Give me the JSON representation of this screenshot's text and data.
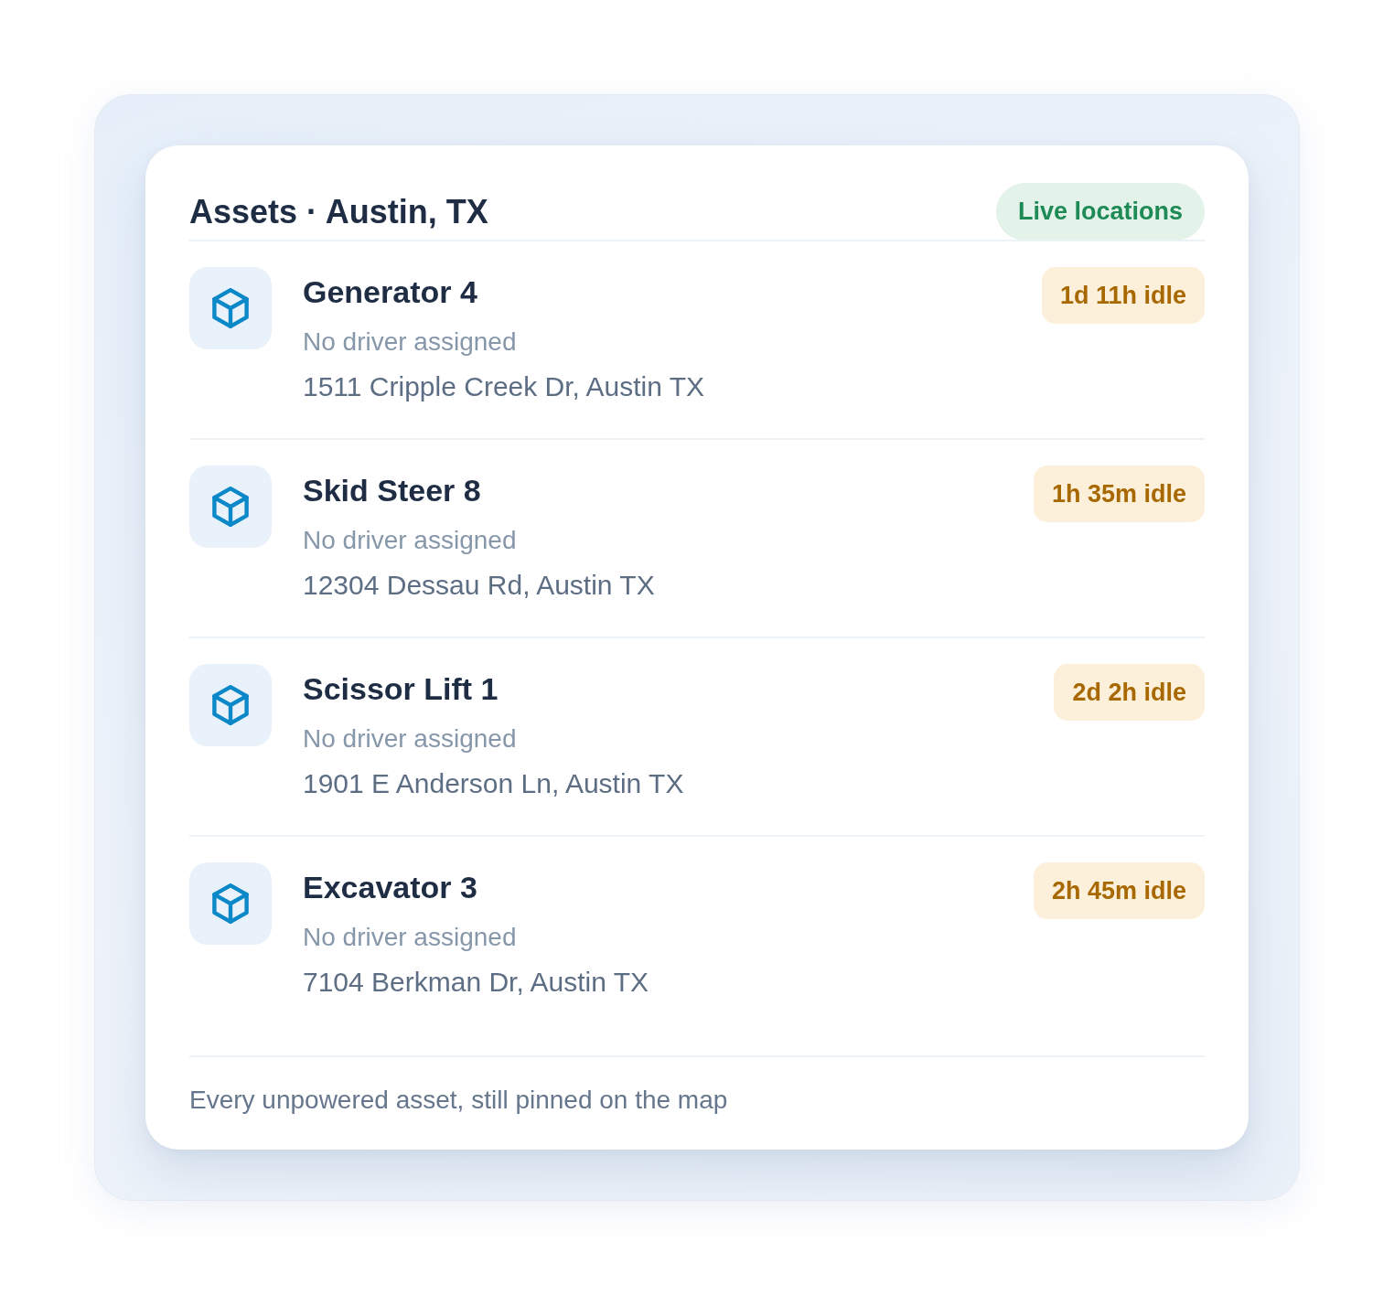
{
  "header": {
    "title": "Assets · Austin, TX",
    "badge": "Live locations"
  },
  "assets": [
    {
      "name": "Generator 4",
      "driver": "No driver assigned",
      "address": "1511 Cripple Creek Dr, Austin TX",
      "idle": "1d 11h idle"
    },
    {
      "name": "Skid Steer 8",
      "driver": "No driver assigned",
      "address": "12304 Dessau Rd, Austin TX",
      "idle": "1h 35m idle"
    },
    {
      "name": "Scissor Lift 1",
      "driver": "No driver assigned",
      "address": "1901 E Anderson Ln, Austin TX",
      "idle": "2d 2h idle"
    },
    {
      "name": "Excavator 3",
      "driver": "No driver assigned",
      "address": "7104 Berkman Dr, Austin TX",
      "idle": "2h 45m idle"
    }
  ],
  "footer": "Every unpowered asset, still pinned on the map"
}
